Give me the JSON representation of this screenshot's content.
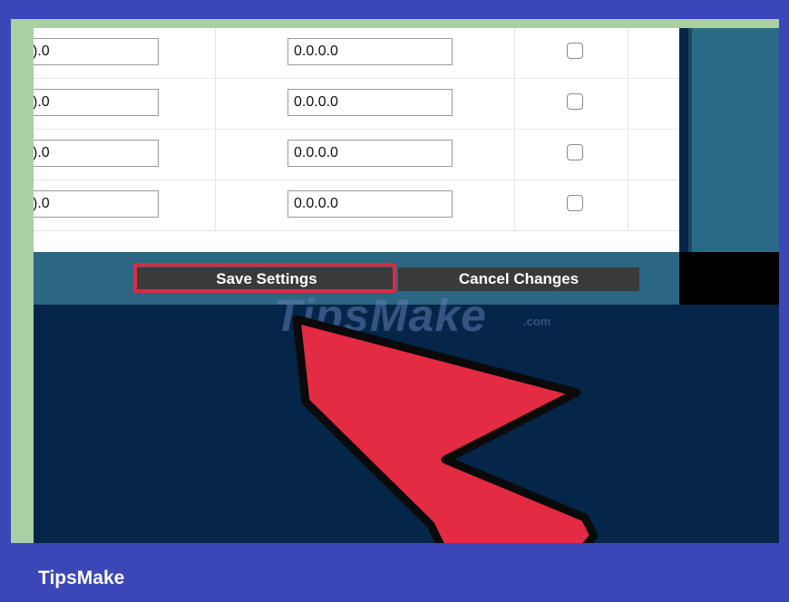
{
  "rows": [
    {
      "ip_start": ").0",
      "ip_end": "0.0.0.0",
      "checked": false
    },
    {
      "ip_start": ").0",
      "ip_end": "0.0.0.0",
      "checked": false
    },
    {
      "ip_start": ").0",
      "ip_end": "0.0.0.0",
      "checked": false
    },
    {
      "ip_start": ").0",
      "ip_end": "0.0.0.0",
      "checked": false
    }
  ],
  "buttons": {
    "save_label": "Save Settings",
    "cancel_label": "Cancel Changes"
  },
  "watermark": {
    "text": "TipsMake",
    "suffix": ".com"
  },
  "caption": "TipsMake",
  "colors": {
    "frame": "#3b47b7",
    "dark_bg": "#052649",
    "bar": "#2b6682",
    "highlight": "#e0293f",
    "arrow": "#e32b43"
  },
  "icons": {
    "pointer": "red-arrow-icon"
  }
}
